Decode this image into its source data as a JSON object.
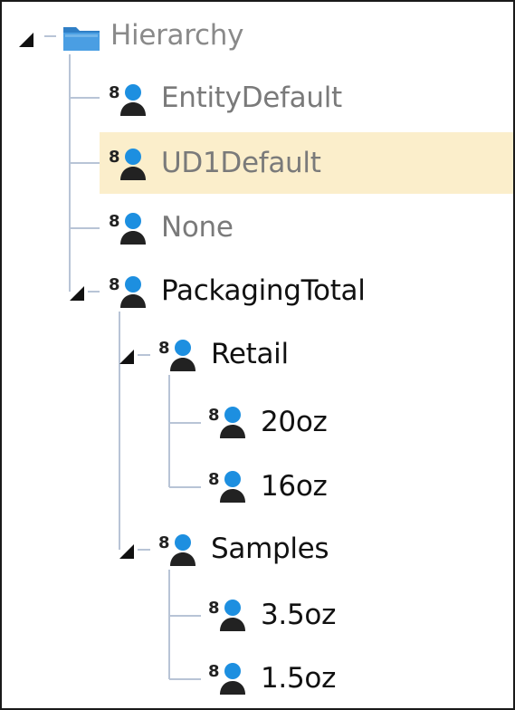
{
  "tree": {
    "root": {
      "label": "Hierarchy",
      "icon": "folder-icon",
      "expanded": true
    },
    "members": {
      "entity_default": {
        "label": "EntityDefault",
        "icon": "member-icon"
      },
      "ud1_default": {
        "label": "UD1Default",
        "icon": "member-icon",
        "selected": true
      },
      "none": {
        "label": "None",
        "icon": "member-icon"
      },
      "packaging_total": {
        "label": "PackagingTotal",
        "icon": "member-icon",
        "expanded": true
      },
      "retail": {
        "label": "Retail",
        "icon": "member-icon",
        "expanded": true
      },
      "oz20": {
        "label": "20oz",
        "icon": "member-icon"
      },
      "oz16": {
        "label": "16oz",
        "icon": "member-icon"
      },
      "samples": {
        "label": "Samples",
        "icon": "member-icon",
        "expanded": true
      },
      "oz35": {
        "label": "3.5oz",
        "icon": "member-icon"
      },
      "oz15": {
        "label": "1.5oz",
        "icon": "member-icon"
      }
    }
  },
  "colors": {
    "selection_background": "#fbeecb",
    "tree_line": "#b8c4d6",
    "icon_blue": "#1d8fe0",
    "icon_dark": "#222222",
    "folder_blue": "#3f8fd6"
  }
}
